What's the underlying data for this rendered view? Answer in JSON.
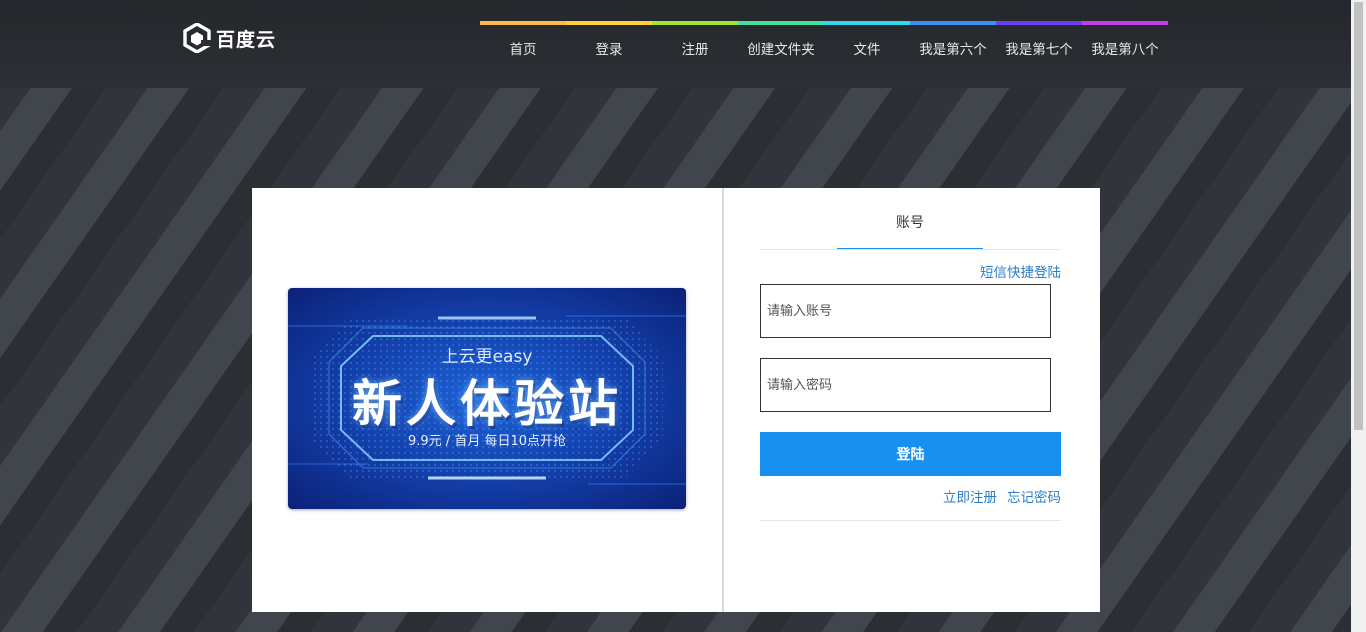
{
  "header": {
    "logo_text": "百度云",
    "nav": [
      {
        "label": "首页",
        "color": "#ffb84d"
      },
      {
        "label": "登录",
        "color": "#ffd23a"
      },
      {
        "label": "注册",
        "color": "#a6e22e"
      },
      {
        "label": "创建文件夹",
        "color": "#3fe0a0"
      },
      {
        "label": "文件",
        "color": "#33d6e8"
      },
      {
        "label": "我是第六个",
        "color": "#3d8ef0"
      },
      {
        "label": "我是第七个",
        "color": "#6a3ff0"
      },
      {
        "label": "我是第八个",
        "color": "#c43ee8"
      }
    ]
  },
  "banner": {
    "tagline": "上云更easy",
    "headline": "新人体验站",
    "offer": "9.9元 / 首月 每日10点开抢"
  },
  "login": {
    "tab_account": "账号",
    "sms_link": "短信快捷登陆",
    "account_placeholder": "请输入账号",
    "password_placeholder": "请输入密码",
    "submit_label": "登陆",
    "register_link": "立即注册",
    "forgot_link": "忘记密码"
  },
  "colors": {
    "accent": "#1790f0",
    "link": "#2a7ec7"
  }
}
